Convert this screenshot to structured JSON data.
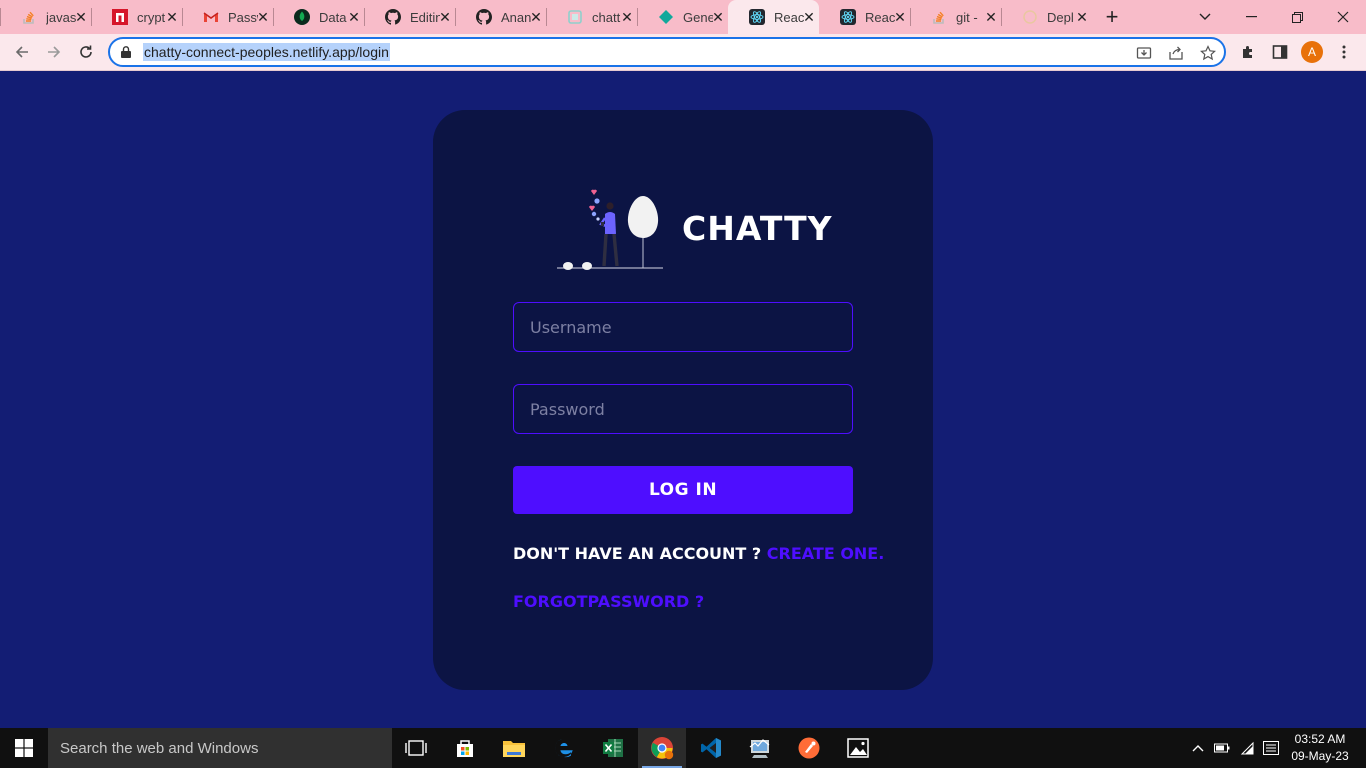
{
  "browser": {
    "tabs": [
      {
        "title": "javas",
        "icon": "stackoverflow-icon"
      },
      {
        "title": "crypt",
        "icon": "red-n-icon"
      },
      {
        "title": "Passw",
        "icon": "gmail-icon"
      },
      {
        "title": "Data",
        "icon": "mongodb-icon"
      },
      {
        "title": "Editin",
        "icon": "github-icon"
      },
      {
        "title": "Anan",
        "icon": "github-icon"
      },
      {
        "title": "chatt",
        "icon": "netlify-icon"
      },
      {
        "title": "Gene",
        "icon": "diamond-icon"
      },
      {
        "title": "Reac",
        "icon": "react-icon",
        "active": true
      },
      {
        "title": "Reac",
        "icon": "react-icon"
      },
      {
        "title": "git -",
        "icon": "stackoverflow-icon"
      },
      {
        "title": "Depl",
        "icon": "deploy-icon"
      }
    ],
    "url": "chatty-connect-peoples.netlify.app/login",
    "avatar_letter": "A"
  },
  "page": {
    "brand_name": "CHATTY",
    "username_placeholder": "Username",
    "password_placeholder": "Password",
    "login_label": "LOG IN",
    "signup_prompt": "DON'T HAVE AN ACCOUNT ? ",
    "signup_link": "CREATE ONE.",
    "forgot_link": "FORGOTPASSWORD ?"
  },
  "taskbar": {
    "search_placeholder": "Search the web and Windows",
    "time": "03:52 AM",
    "date": "09-May-23"
  },
  "colors": {
    "page_bg": "#131d74",
    "card_bg": "#0c1444",
    "accent": "#4e0eff",
    "tabstrip_bg": "#f8bcc9"
  }
}
